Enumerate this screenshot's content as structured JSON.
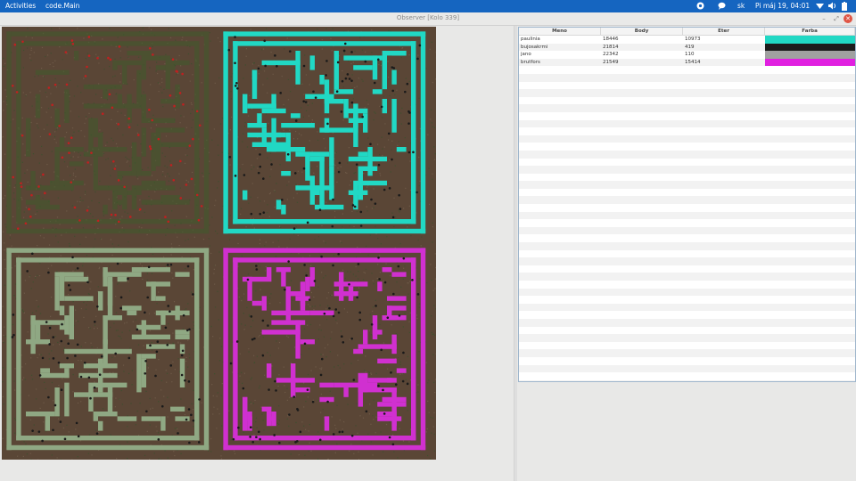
{
  "topbar": {
    "activities": "Activities",
    "app_menu": "code.Main",
    "language": "sk",
    "datetime": "Pi máj 19, 04:01"
  },
  "window": {
    "title": "Observer [Kolo 339]"
  },
  "table": {
    "columns": [
      "Meno",
      "Body",
      "Eter",
      "Farba"
    ],
    "rows": [
      {
        "name": "paulinia",
        "points": "18446",
        "ether": "10973",
        "color": "#21d8c4"
      },
      {
        "name": "bujosakrmi",
        "points": "21814",
        "ether": "419",
        "color": "#1c1c1c"
      },
      {
        "name": "jano",
        "points": "22342",
        "ether": "110",
        "color": "#a0a0a0"
      },
      {
        "name": "brutfors",
        "points": "21549",
        "ether": "15414",
        "color": "#e020e0"
      }
    ],
    "empty_rows": 42
  },
  "colors": {
    "topbar": "#1565c0",
    "cyan_player": "#21d8c4",
    "magenta_player": "#d030d0",
    "sage_player": "#8fa883",
    "dark_player": "#3f5a2c",
    "ground": "#5a4636"
  }
}
